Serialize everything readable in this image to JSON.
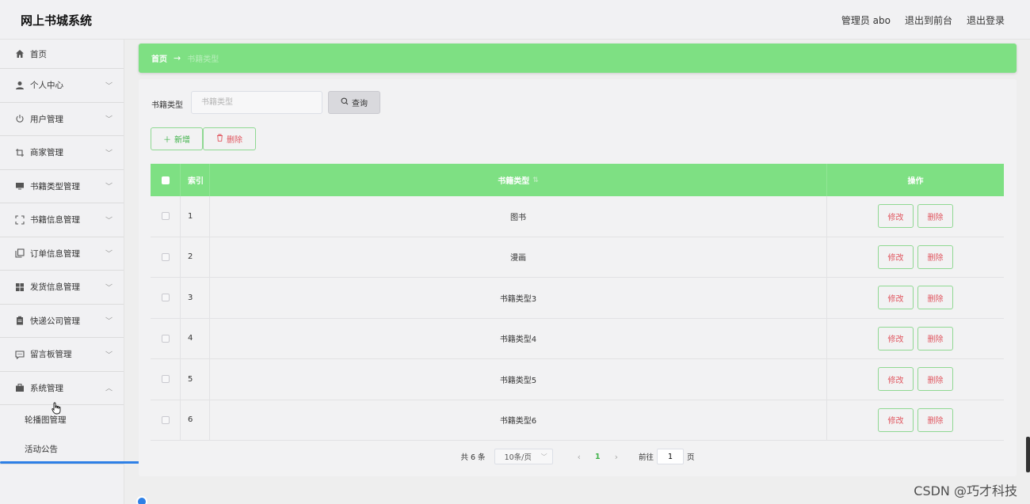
{
  "header": {
    "brand": "网上书城系统",
    "admin_label": "管理员 abo",
    "front_link": "退出到前台",
    "logout_link": "退出登录"
  },
  "sidebar": {
    "items": [
      {
        "label": "首页",
        "icon": "home-icon"
      },
      {
        "label": "个人中心",
        "icon": "user-icon"
      },
      {
        "label": "用户管理",
        "icon": "power-icon"
      },
      {
        "label": "商家管理",
        "icon": "crop-icon"
      },
      {
        "label": "书籍类型管理",
        "icon": "monitor-icon"
      },
      {
        "label": "书籍信息管理",
        "icon": "fullscreen-icon"
      },
      {
        "label": "订单信息管理",
        "icon": "copy-icon"
      },
      {
        "label": "发货信息管理",
        "icon": "grid-icon"
      },
      {
        "label": "快递公司管理",
        "icon": "clipboard-icon"
      },
      {
        "label": "留言板管理",
        "icon": "message-icon"
      },
      {
        "label": "系统管理",
        "icon": "briefcase-icon"
      }
    ],
    "submenu": [
      "轮播图管理",
      "活动公告"
    ]
  },
  "breadcrumb": {
    "home": "首页",
    "arrow": "→",
    "current": "书籍类型"
  },
  "search": {
    "label": "书籍类型",
    "placeholder": "书籍类型",
    "button": "查询"
  },
  "actions": {
    "add": "新增",
    "delete": "删除"
  },
  "table": {
    "headers": {
      "index": "索引",
      "type": "书籍类型",
      "ops": "操作"
    },
    "rows": [
      {
        "index": "1",
        "type": "图书"
      },
      {
        "index": "2",
        "type": "漫画"
      },
      {
        "index": "3",
        "type": "书籍类型3"
      },
      {
        "index": "4",
        "type": "书籍类型4"
      },
      {
        "index": "5",
        "type": "书籍类型5"
      },
      {
        "index": "6",
        "type": "书籍类型6"
      }
    ],
    "edit_label": "修改",
    "delete_label": "删除"
  },
  "pager": {
    "total": "共 6 条",
    "page_size": "10条/页",
    "current_page": "1",
    "goto_prefix": "前往",
    "goto_value": "1",
    "goto_suffix": "页"
  },
  "watermark": "CSDN @巧才科技",
  "colors": {
    "accent": "#7ee083",
    "danger": "#e0565f",
    "link_green": "#3eb148"
  }
}
